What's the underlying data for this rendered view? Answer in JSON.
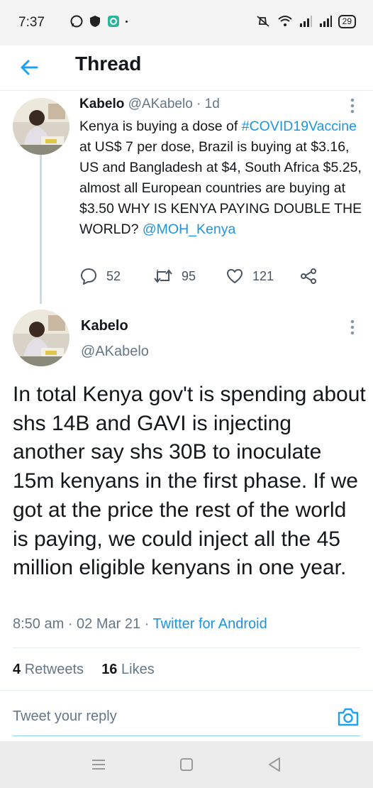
{
  "status_bar": {
    "time": "7:37",
    "battery": "29"
  },
  "header": {
    "title": "Thread"
  },
  "parent_tweet": {
    "name": "Kabelo",
    "handle": "@AKabelo",
    "age": "· 1d",
    "text_before_hashtag": "Kenya is buying a dose of ",
    "hashtag": "#COVID19Vaccine",
    "text_after_hashtag": " at US$ 7 per dose, Brazil is buying at $3.16, US and Bangladesh at $4, South Africa $5.25, almost all European countries are buying at $3.50 WHY IS KENYA PAYING DOUBLE THE WORLD? ",
    "mention": "@MOH_Kenya",
    "replies": "52",
    "retweets": "95",
    "likes": "121"
  },
  "main_tweet": {
    "name": "Kabelo",
    "handle": "@AKabelo",
    "text": "In total Kenya gov't is spending about shs 14B and GAVI is injecting another say shs 30B to inoculate 15m kenyans in the first phase. If we got at the price the rest of the world is paying, we could inject all the 45 million eligible kenyans in one year.",
    "time": "8:50 am",
    "date": "02 Mar 21",
    "source": "Twitter for Android",
    "retweet_count": "4",
    "retweet_label": "Retweets",
    "like_count": "16",
    "like_label": "Likes"
  },
  "reply_bar": {
    "placeholder": "Tweet your reply"
  },
  "colors": {
    "accent": "#1da1f2",
    "link": "#1b95e0",
    "muted": "#657786",
    "text": "#14171a"
  }
}
